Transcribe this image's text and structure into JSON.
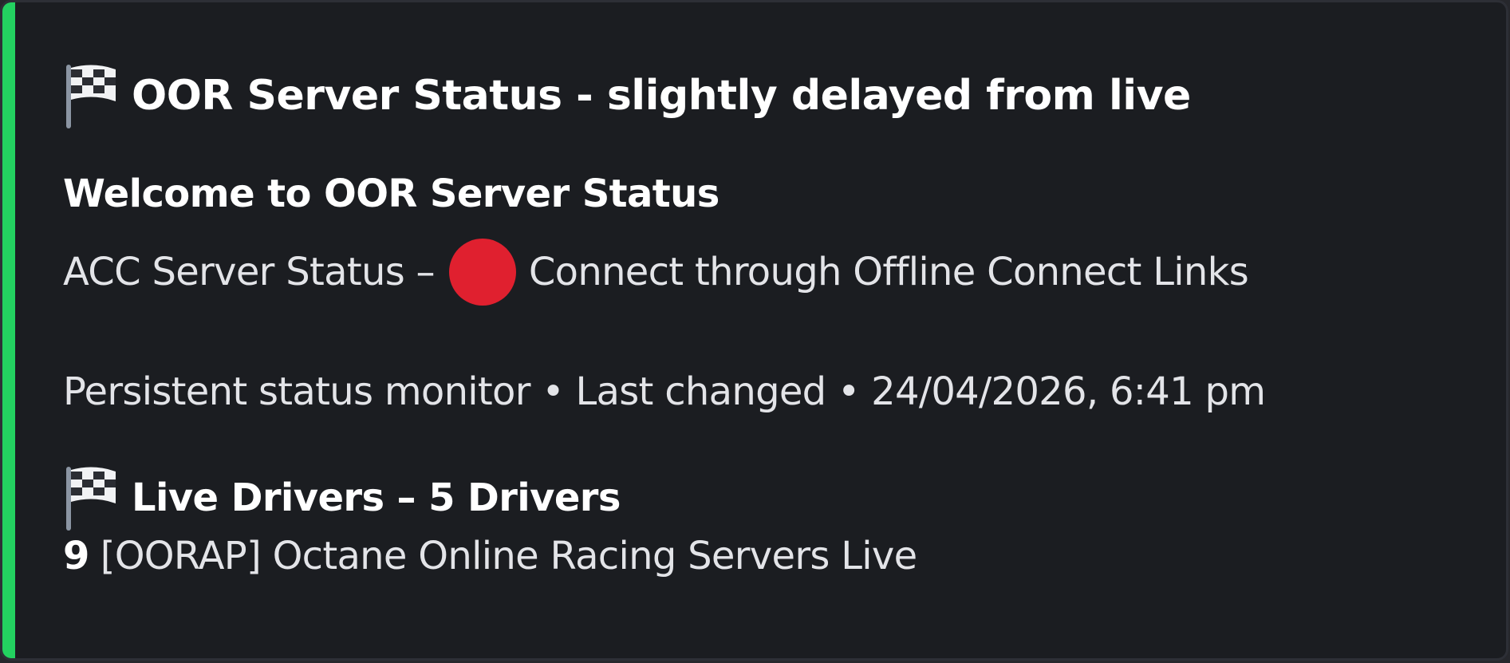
{
  "embed": {
    "accent_color": "#23d160",
    "title_icon": "checkered-flag-icon",
    "title": "OOR Server Status - slightly delayed from live",
    "welcome_heading": "Welcome to OOR Server Status",
    "status_prefix": "ACC Server Status –",
    "status_indicator": "red-circle-icon",
    "status_indicator_color": "#e0202f",
    "status_text": "Connect through Offline Connect Links",
    "footer": "Persistent status monitor • Last changed • 24/04/2026, 6:41 pm",
    "drivers_icon": "checkered-flag-icon",
    "drivers_heading": "Live Drivers – 5 Drivers",
    "server_count": "9",
    "server_name": "[OORAP] Octane Online Racing Servers Live"
  }
}
